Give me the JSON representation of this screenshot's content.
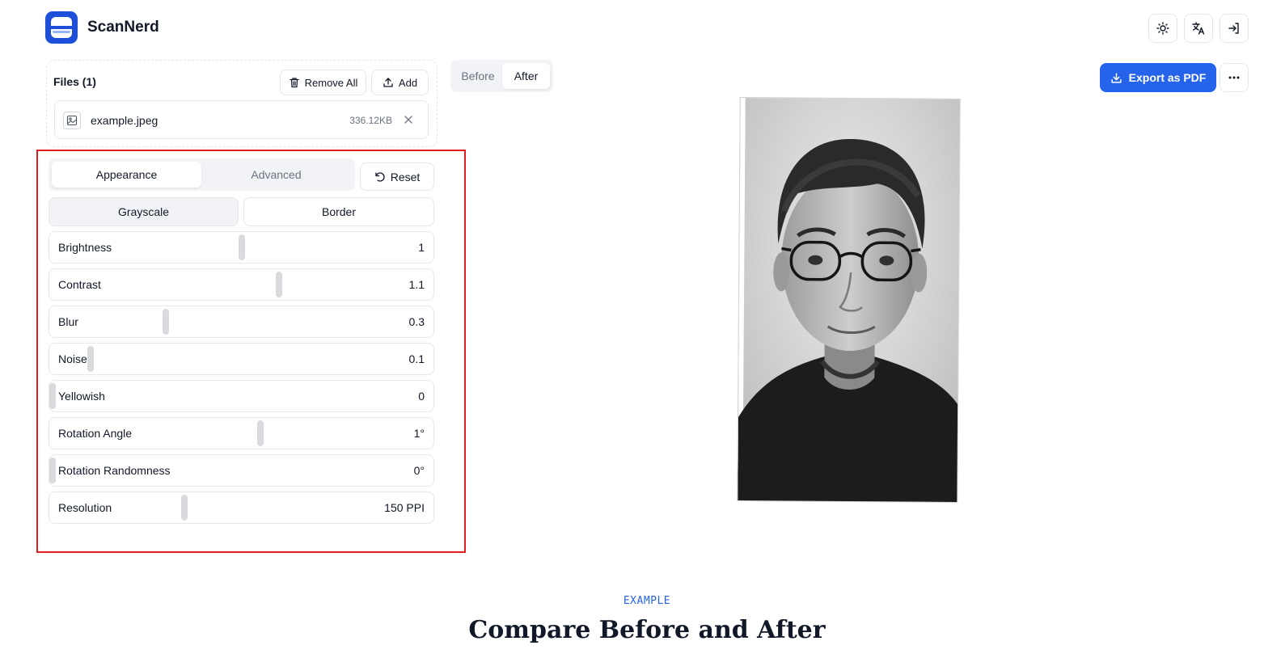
{
  "app": {
    "title": "ScanNerd"
  },
  "header": {
    "icons": [
      "sun-icon",
      "translate-icon",
      "login-icon"
    ]
  },
  "files": {
    "title": "Files (1)",
    "remove_all_label": "Remove All",
    "add_label": "Add",
    "items": [
      {
        "name": "example.jpeg",
        "size": "336.12KB"
      }
    ]
  },
  "settings": {
    "tabs": [
      {
        "label": "Appearance",
        "active": true
      },
      {
        "label": "Advanced",
        "active": false
      }
    ],
    "reset_label": "Reset",
    "modes": [
      {
        "label": "Grayscale",
        "active": true
      },
      {
        "label": "Border",
        "active": false
      }
    ],
    "sliders": [
      {
        "label": "Brightness",
        "value": "1",
        "fraction": 0.5
      },
      {
        "label": "Contrast",
        "value": "1.1",
        "fraction": 0.6
      },
      {
        "label": "Blur",
        "value": "0.3",
        "fraction": 0.3
      },
      {
        "label": "Noise",
        "value": "0.1",
        "fraction": 0.1
      },
      {
        "label": "Yellowish",
        "value": "0",
        "fraction": 0.0
      },
      {
        "label": "Rotation Angle",
        "value": "1°",
        "fraction": 0.55
      },
      {
        "label": "Rotation Randomness",
        "value": "0°",
        "fraction": 0.0
      },
      {
        "label": "Resolution",
        "value": "150 PPI",
        "fraction": 0.35
      }
    ]
  },
  "preview": {
    "toggle": {
      "before_label": "Before",
      "after_label": "After",
      "selected": "After"
    },
    "export_label": "Export as PDF"
  },
  "section": {
    "eyebrow": "EXAMPLE",
    "title": "Compare Before and After"
  },
  "colors": {
    "accent": "#2563eb",
    "highlight_border": "#e11d1d"
  }
}
